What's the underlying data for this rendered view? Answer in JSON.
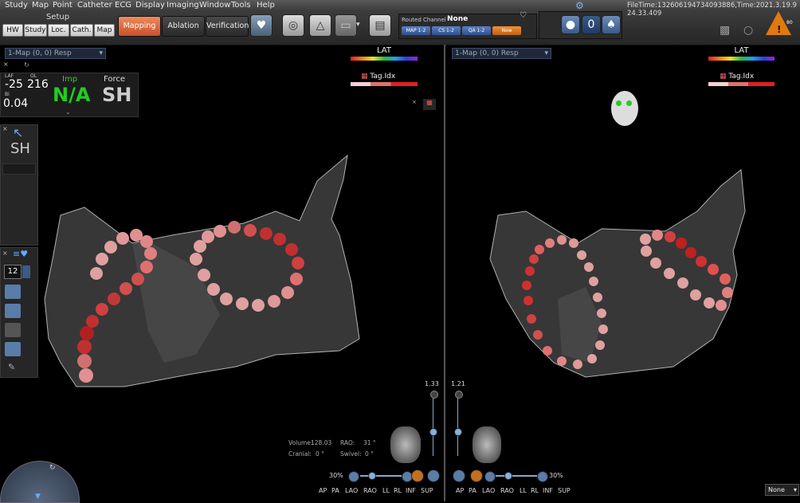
{
  "menu": [
    "Study",
    "Map",
    "Point",
    "Catheter",
    "ECG",
    "Display",
    "Imaging",
    "Window",
    "Tools",
    "Help"
  ],
  "setup": {
    "title": "Setup",
    "buttons": [
      "HW",
      "Study",
      "Loc.",
      "Cath.",
      "Map"
    ]
  },
  "modes": {
    "mapping": "Mapping",
    "ablation": "Ablation",
    "verification": "Verification"
  },
  "routed": {
    "label": "Routed Channel",
    "value": "None",
    "channels": [
      "MAP 1-2",
      "CS 1-2",
      "QA 1-2",
      "New"
    ]
  },
  "counter": "0",
  "file_time": "FileTime:132606194734093886,Time:2021.3.19.9 24.33.409",
  "warning_number": "80",
  "left_view": {
    "map_select": "1-Map (0, 0) Resp",
    "lat_label": "LAT",
    "tag_label": "Tag.Idx",
    "laf_label": "LAF",
    "laf_value": "-25",
    "ol_label": "OL",
    "ol_value": "216",
    "bi_label": "Bi",
    "bi_value": "0.04",
    "imp_label": "Imp",
    "imp_value": "N/A",
    "force_label": "Force",
    "force_value": "SH",
    "side_value": "SH",
    "side_number": "12",
    "zoom": "1.33",
    "volume_label": "Volume:",
    "volume_value": "128.03",
    "rao_label": "RAO:",
    "rao_value": "31 °",
    "cranial_label": "Cranial:",
    "cranial_value": "0 °",
    "swivel_label": "Swivel:",
    "swivel_value": "0 °",
    "opacity": "30%",
    "views": [
      "AP",
      "PA",
      "LAO",
      "RAO",
      "LL",
      "RL",
      "INF",
      "SUP"
    ]
  },
  "right_view": {
    "map_select": "1-Map (0, 0) Resp",
    "lat_label": "LAT",
    "tag_label": "Tag.Idx",
    "zoom": "1.21",
    "opacity": "30%",
    "views": [
      "AP",
      "PA",
      "LAO",
      "RAO",
      "LL",
      "RL",
      "INF",
      "SUP"
    ],
    "none_select": "None"
  }
}
